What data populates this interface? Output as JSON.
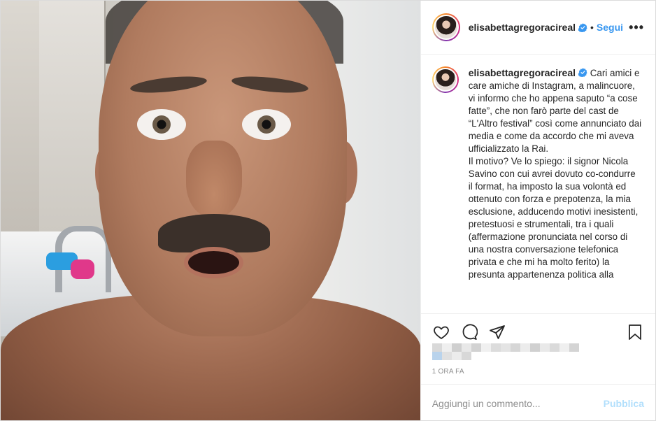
{
  "post": {
    "username": "elisabettagregoracireal",
    "follow_label": "Segui",
    "separator": "•",
    "more_label": "•••",
    "caption_paragraphs": [
      "Cari amici e care amiche di Instagram, a malincuore, vi informo che ho appena saputo “a cose fatte”, che non farò parte del cast de “L'Altro festival” così come annunciato dai media e come da accordo che mi aveva ufficializzato la Rai.",
      "Il motivo? Ve lo spiego: il signor Nicola Savino con cui avrei dovuto co-condurre il format, ha imposto la sua volontà ed ottenuto con forza e prepotenza, la mia esclusione, adducendo motivi inesistenti, pretestuosi e strumentali, tra i quali (affermazione pronunciata nel corso di una nostra conversazione telefonica privata e che mi ha molto ferito) la presunta appartenenza politica alla"
    ],
    "time_label": "1 ORA FA",
    "comment_placeholder": "Aggiungi un commento...",
    "publish_label": "Pubblica"
  },
  "icons": {
    "like": "heart-icon",
    "comment": "comment-icon",
    "share": "share-icon",
    "save": "bookmark-icon",
    "verified": "verified-badge-icon"
  },
  "colors": {
    "accent": "#3897f0",
    "publish_disabled": "#b2dffc",
    "meta_text": "#8e8e8e",
    "border": "#efefef"
  }
}
